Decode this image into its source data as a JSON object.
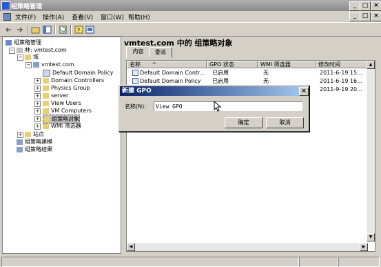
{
  "window": {
    "title": "组策略管理",
    "min": "_",
    "max": "□",
    "close": "×"
  },
  "mdi": {
    "min": "_",
    "restore": "□",
    "close": "×"
  },
  "menu": [
    {
      "label": "文件(F)"
    },
    {
      "label": "操作(A)"
    },
    {
      "label": "查看(V)"
    },
    {
      "label": "窗口(W)"
    },
    {
      "label": "帮助(H)"
    }
  ],
  "toolbar": {
    "back_icon": "back-arrow-icon",
    "forward_icon": "forward-arrow-icon",
    "up_icon": "up-folder-icon",
    "console_icon": "console-tree-icon",
    "refresh_icon": "refresh-icon",
    "help_icon": "help-icon",
    "props_icon": "properties-icon"
  },
  "tree": {
    "items": [
      {
        "label": "组策略管理",
        "pm": ""
      },
      {
        "label": "林: vmtest.com",
        "pm": "−"
      },
      {
        "label": "域",
        "pm": "−"
      },
      {
        "label": "vmtest.com",
        "pm": "−"
      },
      {
        "label": "Default Domain Policy",
        "pm": ""
      },
      {
        "label": "Domain Controllers",
        "pm": "+"
      },
      {
        "label": "Physics Group",
        "pm": "+"
      },
      {
        "label": "server",
        "pm": "+"
      },
      {
        "label": "View Users",
        "pm": "+"
      },
      {
        "label": "VM Computers",
        "pm": "+"
      },
      {
        "label": "组策略对象",
        "pm": "+"
      },
      {
        "label": "WMI 筛选器",
        "pm": "+"
      },
      {
        "label": "站点",
        "pm": "+"
      },
      {
        "label": "组策略建模",
        "pm": ""
      },
      {
        "label": "组策略结果",
        "pm": ""
      }
    ]
  },
  "right": {
    "title": "vmtest.com 中的 组策略对象",
    "tabs": [
      {
        "label": "内容"
      },
      {
        "label": "委派"
      }
    ],
    "columns": [
      "名称",
      "GPO 状态",
      "WMI 筛选器",
      "修改时间"
    ],
    "sort_indicator": "^",
    "rows": [
      {
        "name": "Default Domain Contr...",
        "status": "已启用",
        "wmi": "无",
        "time": "2011-6-19 15..."
      },
      {
        "name": "Default Domain Policy",
        "status": "已启用",
        "wmi": "无",
        "time": "2011-6-19 16..."
      },
      {
        "name": "",
        "status": "",
        "wmi": "",
        "time": "2011-9-19 20..."
      }
    ]
  },
  "dialog": {
    "title": "新建 GPO",
    "name_label": "名称(N):",
    "name_value": "View GPO",
    "ok": "确定",
    "cancel": "取消",
    "close": "×"
  },
  "colors": {
    "title_active": "#0a246a",
    "title_inactive": "#8a8a8a",
    "face": "#d4d0c8"
  }
}
